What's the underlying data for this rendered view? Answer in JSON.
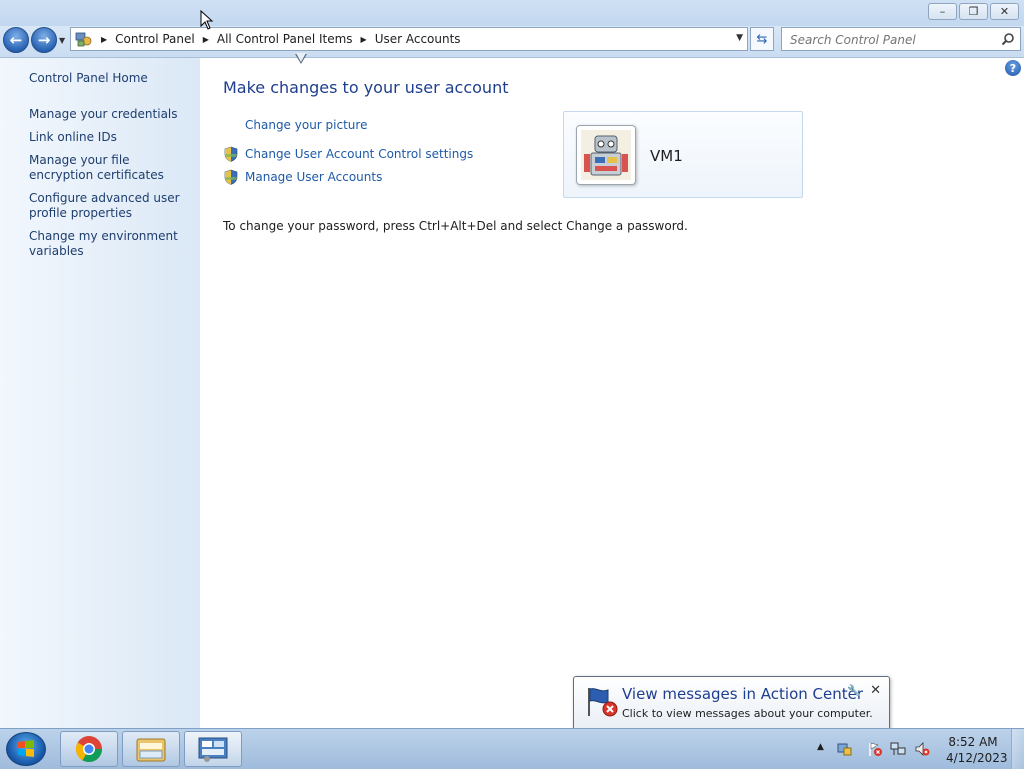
{
  "titlebar": {
    "minimize_glyph": "–",
    "maximize_glyph": "❐",
    "close_glyph": "✕"
  },
  "navigation": {
    "back_glyph": "←",
    "forward_glyph": "→",
    "breadcrumbs": [
      "Control Panel",
      "All Control Panel Items",
      "User Accounts"
    ],
    "search_placeholder": "Search Control Panel"
  },
  "sidebar": {
    "home_label": "Control Panel Home",
    "links": [
      "Manage your credentials",
      "Link online IDs",
      "Manage your file encryption certificates",
      "Configure advanced user profile properties",
      "Change my environment variables"
    ]
  },
  "main": {
    "title": "Make changes to your user account",
    "tasks": [
      {
        "label": "Change your picture",
        "shield": false
      },
      {
        "label": "Change User Account Control settings",
        "shield": true
      },
      {
        "label": "Manage User Accounts",
        "shield": true
      }
    ],
    "password_note": "To change your password, press Ctrl+Alt+Del and select Change a password.",
    "user": {
      "name": "VM1",
      "picture_icon": "robot-picture-icon"
    }
  },
  "balloon": {
    "title": "View messages in Action Center",
    "text": "Click to view messages about your computer."
  },
  "taskbar": {
    "pinned": [
      "chrome-icon",
      "windows-explorer-icon",
      "control-panel-icon"
    ],
    "clock_time": "8:52 AM",
    "clock_date": "4/12/2023"
  },
  "colors": {
    "link": "#1e5aa8",
    "title": "#1e3e8e",
    "sidebar_bg": "#dbe8f6",
    "taskbar": "#9fbbdc"
  }
}
